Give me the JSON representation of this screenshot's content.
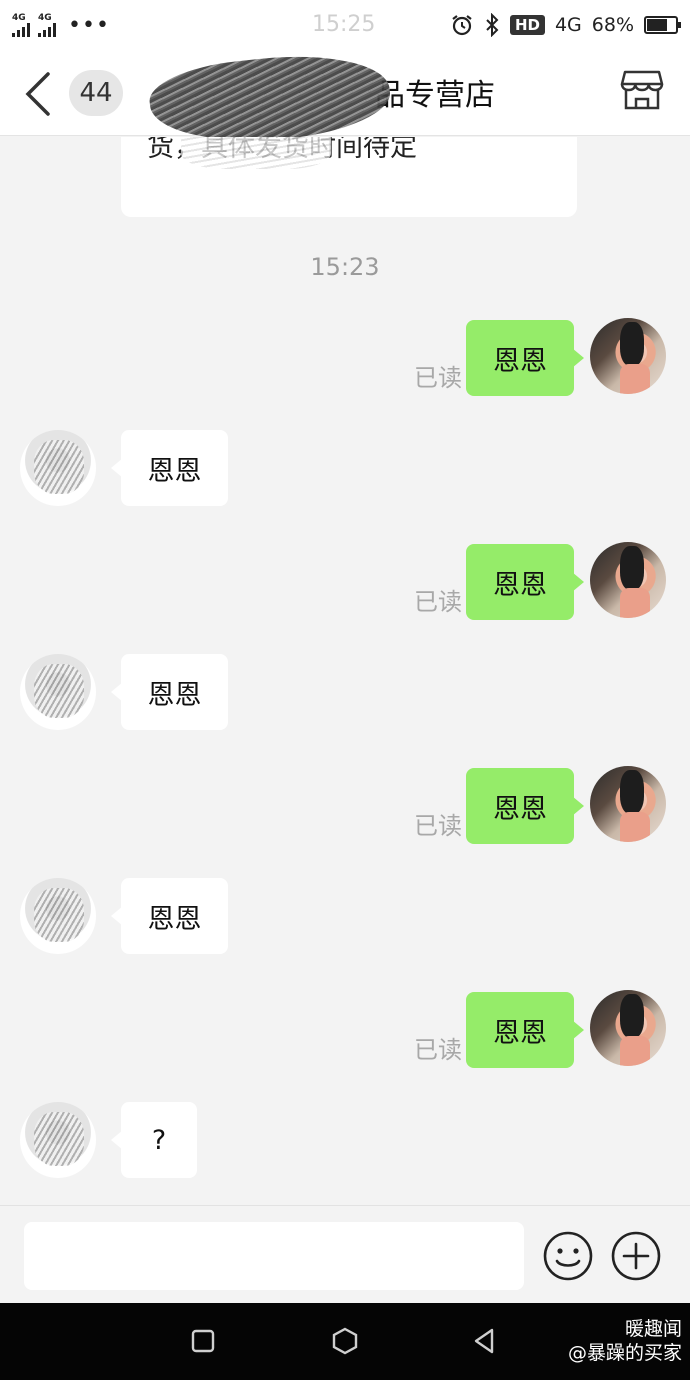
{
  "status_bar": {
    "sim1": "4G",
    "sim2": "4G",
    "dots": "•••",
    "time": "15:25",
    "hd": "HD",
    "network": "4G",
    "battery": "68%",
    "battery_level": 0.68
  },
  "header": {
    "unread_count": "44",
    "title": "品专营店"
  },
  "chat": {
    "previous_message": "货，具体发货时间待定",
    "timestamp": "15:23",
    "read_label": "已读",
    "messages": [
      {
        "from": "me",
        "text": "恩恩"
      },
      {
        "from": "other",
        "text": "恩恩"
      },
      {
        "from": "me",
        "text": "恩恩"
      },
      {
        "from": "other",
        "text": "恩恩"
      },
      {
        "from": "me",
        "text": "恩恩"
      },
      {
        "from": "other",
        "text": "恩恩"
      },
      {
        "from": "me",
        "text": "恩恩"
      },
      {
        "from": "other",
        "text": "?"
      }
    ]
  },
  "input": {
    "value": "",
    "placeholder": ""
  },
  "watermark": {
    "line1": "暖趣闻",
    "line2": "@暴躁的买家"
  },
  "colors": {
    "my_bubble": "#95ec69",
    "other_bubble": "#ffffff",
    "background": "#f3f3f3"
  }
}
